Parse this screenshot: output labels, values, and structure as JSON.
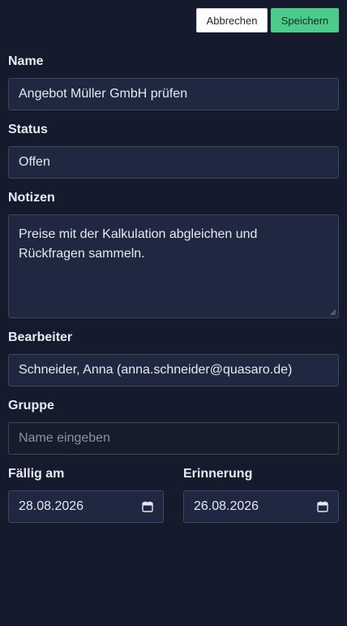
{
  "toolbar": {
    "cancel_label": "Abbrechen",
    "save_label": "Speichern"
  },
  "form": {
    "name": {
      "label": "Name",
      "value": "Angebot Müller GmbH prüfen"
    },
    "status": {
      "label": "Status",
      "value": "Offen"
    },
    "notes": {
      "label": "Notizen",
      "line1": "Preise mit der Kalkulation abgleichen und",
      "line2": "Rückfragen sammeln."
    },
    "assignee": {
      "label": "Bearbeiter",
      "value": "Schneider, Anna (anna.schneider@quasaro.de)"
    },
    "group": {
      "label": "Gruppe",
      "placeholder": "Name eingeben"
    },
    "due": {
      "label": "Fällig am",
      "value": "28.08.2026"
    },
    "reminder": {
      "label": "Erinnerung",
      "value": "26.08.2026"
    }
  },
  "icons": {
    "date_picker": "calendar-icon",
    "resize": "resize-handle-icon"
  },
  "colors": {
    "background": "#151b2c",
    "field_background": "#1f2840",
    "field_border": "#3c465c",
    "save_button": "#4ccb8d",
    "cancel_button": "#ffffff"
  }
}
